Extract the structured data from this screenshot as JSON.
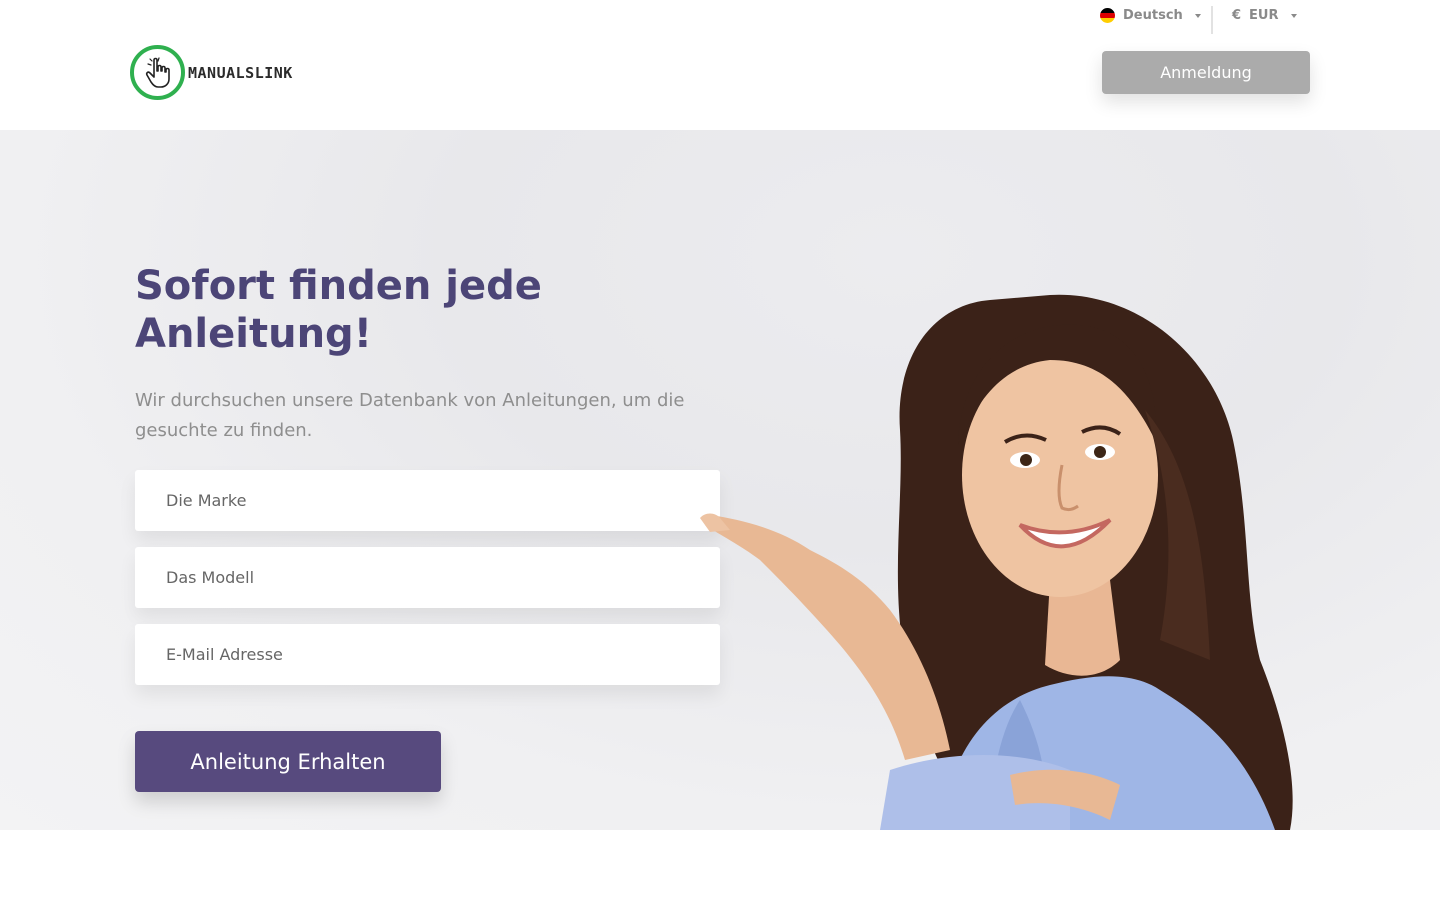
{
  "topbar": {
    "language": {
      "label": "Deutsch",
      "flag_colors": [
        "#000000",
        "#dd0000",
        "#ffce00"
      ]
    },
    "currency": {
      "symbol": "€",
      "code": "EUR"
    }
  },
  "header": {
    "logo_text": "MANUALSLINK",
    "logo_color": "#2fb04f",
    "login_label": "Anmeldung"
  },
  "hero": {
    "title": "Sofort finden jede Anleitung!",
    "subtitle": "Wir durchsuchen unsere Datenbank von Anleitungen, um die gesuchte zu finden.",
    "brand_placeholder": "Die Marke",
    "model_placeholder": "Das Modell",
    "email_placeholder": "E-Mail Adresse",
    "cta_label": "Anleitung Erhalten",
    "accent_color": "#574a7e"
  }
}
